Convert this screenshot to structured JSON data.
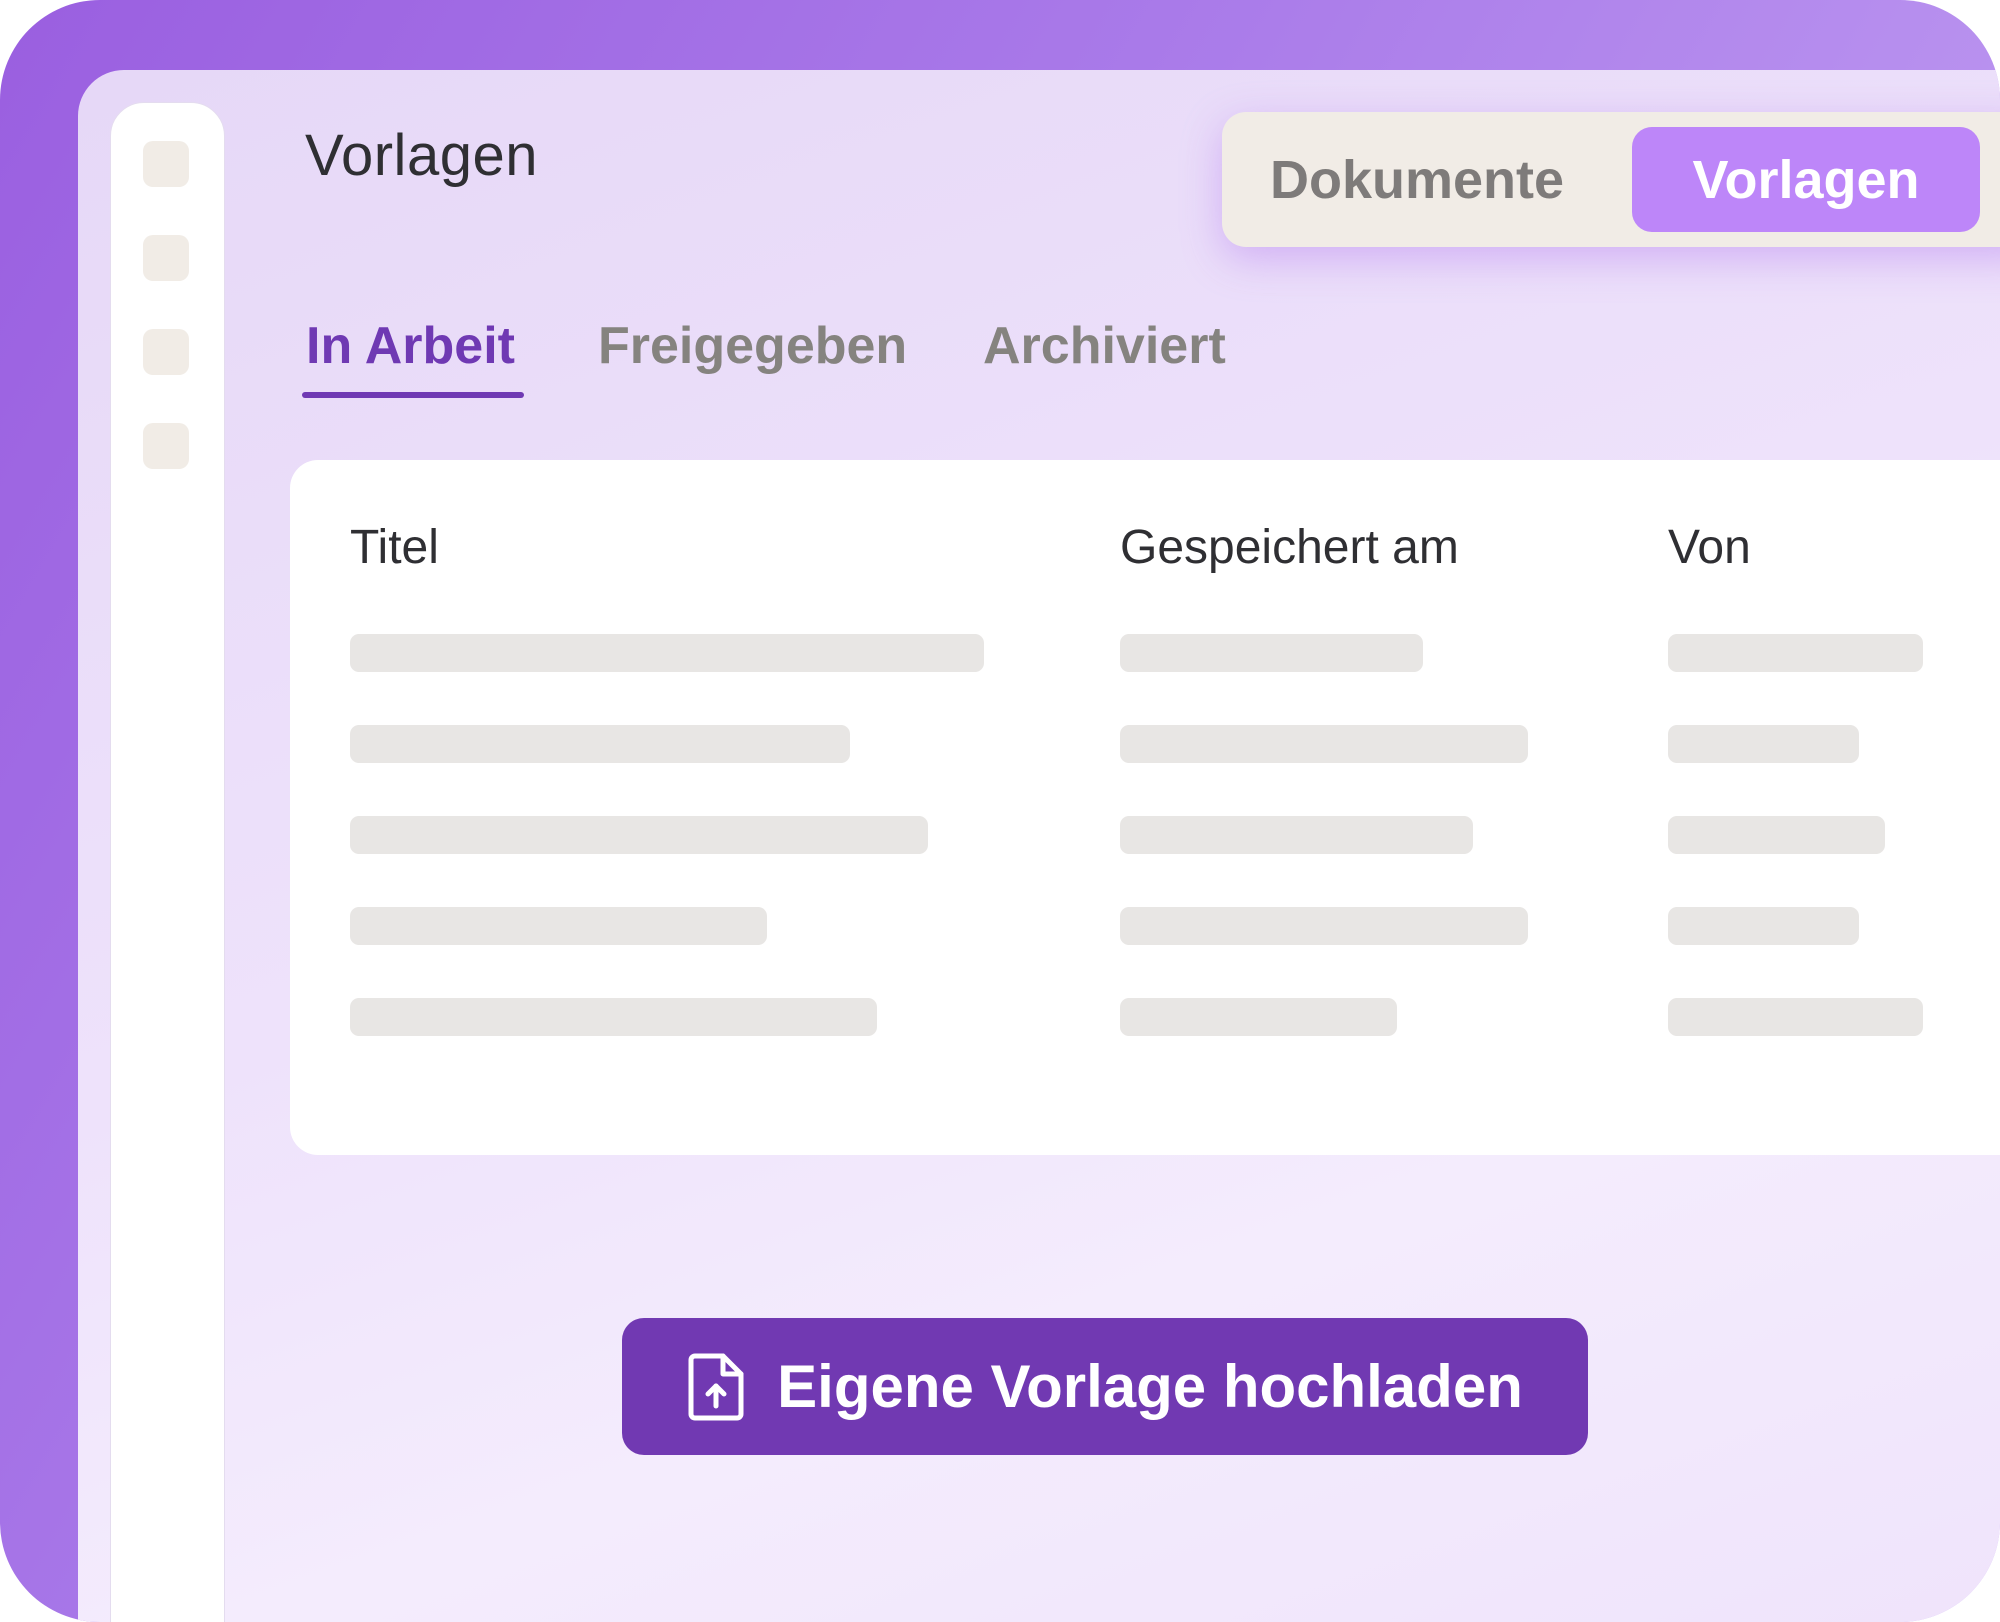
{
  "header": {
    "title": "Vorlagen"
  },
  "view_toggle": {
    "options": [
      "Dokumente",
      "Vorlagen"
    ],
    "selected": "Vorlagen"
  },
  "tabs": [
    {
      "label": "In Arbeit",
      "active": true
    },
    {
      "label": "Freigegeben",
      "active": false
    },
    {
      "label": "Archiviert",
      "active": false
    }
  ],
  "table": {
    "columns": [
      "Titel",
      "Gespeichert am",
      "Von"
    ],
    "rows": 5,
    "placeholder_rows": true
  },
  "upload": {
    "label": "Eigene Vorlage hochladen",
    "icon": "file-upload-icon"
  },
  "colors": {
    "accent": "#6f39b3",
    "toggle_active": "#bd86f9",
    "button": "#7139b2",
    "placeholder": "#e8e6e4"
  }
}
